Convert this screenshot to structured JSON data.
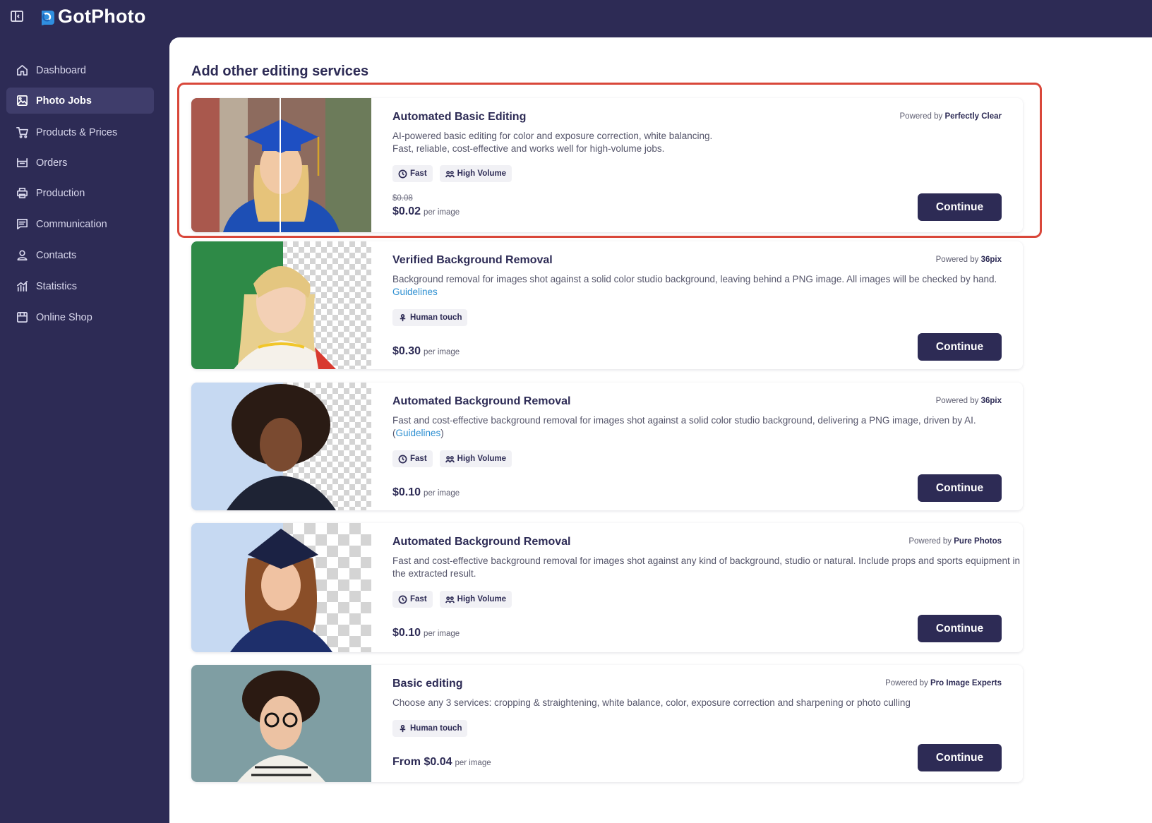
{
  "app": {
    "name": "GotPhoto"
  },
  "colors": {
    "sidebar": "#2d2b55",
    "accent": "#2d2b55",
    "highlight": "#d9473a",
    "link": "#2d8fd1"
  },
  "sidebar": {
    "items": [
      {
        "label": "Dashboard",
        "icon": "home-icon",
        "active": false
      },
      {
        "label": "Photo Jobs",
        "icon": "image-icon",
        "active": true
      },
      {
        "label": "Products & Prices",
        "icon": "cart-icon",
        "active": false
      },
      {
        "label": "Orders",
        "icon": "orders-icon",
        "active": false
      },
      {
        "label": "Production",
        "icon": "printer-icon",
        "active": false
      },
      {
        "label": "Communication",
        "icon": "message-icon",
        "active": false
      },
      {
        "label": "Contacts",
        "icon": "user-icon",
        "active": false
      },
      {
        "label": "Statistics",
        "icon": "chart-icon",
        "active": false
      },
      {
        "label": "Online Shop",
        "icon": "shop-icon",
        "active": false
      }
    ]
  },
  "main": {
    "title": "Add other editing services",
    "powered_prefix": "Powered by",
    "per_image": "per image",
    "continue_label": "Continue",
    "services": [
      {
        "title": "Automated Basic Editing",
        "provider": "Perfectly Clear",
        "description": "AI-powered basic editing for color and exposure correction, white balancing.",
        "description_2": "Fast, reliable, cost-effective and works well for high-volume jobs.",
        "tags": [
          "Fast",
          "High Volume"
        ],
        "old_price": "$0.08",
        "price": "$0.02"
      },
      {
        "title": "Verified Background Removal",
        "provider": "36pix",
        "description": "Background removal for images shot against a solid color studio background, leaving behind a PNG image. All images will be checked by hand.",
        "link": "Guidelines",
        "tags": [
          "Human touch"
        ],
        "price": "$0.30"
      },
      {
        "title": "Automated Background Removal",
        "provider": "36pix",
        "description": "Fast and cost-effective background removal for images shot against a solid color studio background, delivering a PNG image, driven by AI.",
        "link": "Guidelines",
        "tags": [
          "Fast",
          "High Volume"
        ],
        "price": "$0.10"
      },
      {
        "title": "Automated Background Removal",
        "provider": "Pure Photos",
        "description": "Fast and cost-effective background removal for images shot against any kind of background, studio or natural. Include props and sports equipment in the extracted result.",
        "tags": [
          "Fast",
          "High Volume"
        ],
        "price": "$0.10"
      },
      {
        "title": "Basic editing",
        "provider": "Pro Image Experts",
        "description": "Choose any 3 services: cropping & straightening, white balance, color, exposure correction and sharpening or photo culling",
        "tags": [
          "Human touch"
        ],
        "price": "From $0.04"
      }
    ]
  }
}
